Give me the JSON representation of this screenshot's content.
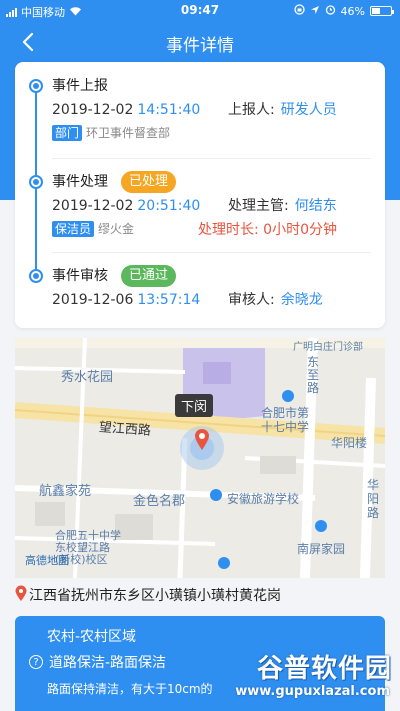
{
  "statusbar": {
    "carrier": "中国移动",
    "time": "09:47",
    "battery": "46%",
    "battery_level": 0.46
  },
  "nav": {
    "title": "事件详情"
  },
  "timeline": {
    "report": {
      "name": "事件上报",
      "date": "2019-12-02",
      "time": "14:51:40",
      "person_label": "上报人:",
      "person": "研发人员",
      "chip": "部门",
      "sub": "环卫事件督查部"
    },
    "handle": {
      "name": "事件处理",
      "tag": "已处理",
      "date": "2019-12-02",
      "time": "20:51:40",
      "person_label": "处理主管:",
      "person": "何结东",
      "chip": "保洁员",
      "sub": "缪火金",
      "duration": "处理时长: 0小时0分钟"
    },
    "review": {
      "name": "事件审核",
      "tag": "已通过",
      "date": "2019-12-06",
      "time": "13:57:14",
      "person_label": "审核人:",
      "person": "余晓龙"
    }
  },
  "map": {
    "marker_label": "下闵",
    "labels": {
      "xiushui": "秀水花园",
      "wangjiang": "望江西路",
      "hangxin": "航鑫家苑",
      "jinse": "金色名郡",
      "hefei17": "合肥市第\n十七中学",
      "anhui": "安徽旅游学校",
      "hefei50": "合肥五十中学\n东校望江路\n(新校)校区",
      "huayang": "华阳楼",
      "huayang_road": "华\n阳\n路",
      "nanping": "南屏家园",
      "dongzhi": "东\n至\n路",
      "top_right": "广明白庄门诊部",
      "amap": "高德地图"
    }
  },
  "address": "江西省抚州市东乡区小璜镇小璜村黄花岗",
  "bottom": {
    "area": "农村-农村区域",
    "category": "道路保洁-路面保洁",
    "desc": "路面保持清洁，有大于10cm的"
  },
  "watermark": {
    "brand": "谷普软件园",
    "url": "www.gupuxlazal.com"
  },
  "colors": {
    "primary": "#2f8ff0",
    "orange": "#f5a623",
    "green": "#5cb85c",
    "red": "#e8553e"
  }
}
